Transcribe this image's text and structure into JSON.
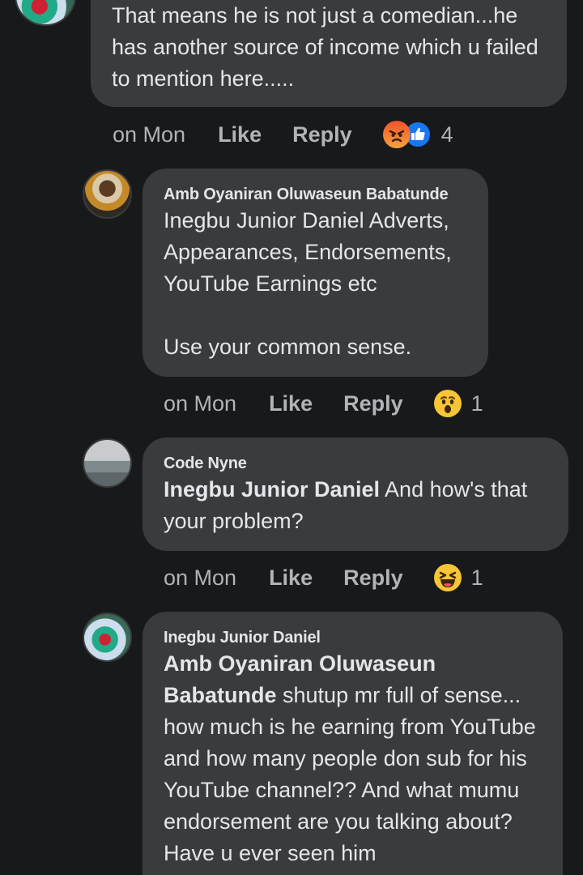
{
  "comments": [
    {
      "text": "That means he is not just a comedian...he has another source of income which u failed to mention here.....",
      "time": "on Mon",
      "like": "Like",
      "reply": "Reply",
      "reactions": [
        "angry",
        "like"
      ],
      "reaction_count": "4"
    },
    {
      "author": "Amb Oyaniran Oluwaseun Babatunde",
      "text": "Inegbu Junior Daniel Adverts, Appearances, Endorsements, YouTube Earnings etc\n\nUse your common sense.",
      "time": "on Mon",
      "like": "Like",
      "reply": "Reply",
      "reactions": [
        "wow"
      ],
      "reaction_count": "1"
    },
    {
      "author": "Code Nyne",
      "mention": "Inegbu Junior Daniel",
      "text": " And how's that your problem?",
      "time": "on Mon",
      "like": "Like",
      "reply": "Reply",
      "reactions": [
        "haha"
      ],
      "reaction_count": "1"
    },
    {
      "author": "Inegbu Junior Daniel",
      "mention": "Amb Oyaniran Oluwaseun Babatunde",
      "text": " shutup mr full of sense... how much is he earning from YouTube and how many people don sub for his YouTube channel?? And what mumu endorsement are you talking about? Have u ever seen him"
    }
  ],
  "colors": {
    "background": "#18191a",
    "bubble": "#3a3b3c",
    "primary_text": "#e4e6eb",
    "secondary_text": "#b0b3b8",
    "like_blue": "#1877f2"
  }
}
